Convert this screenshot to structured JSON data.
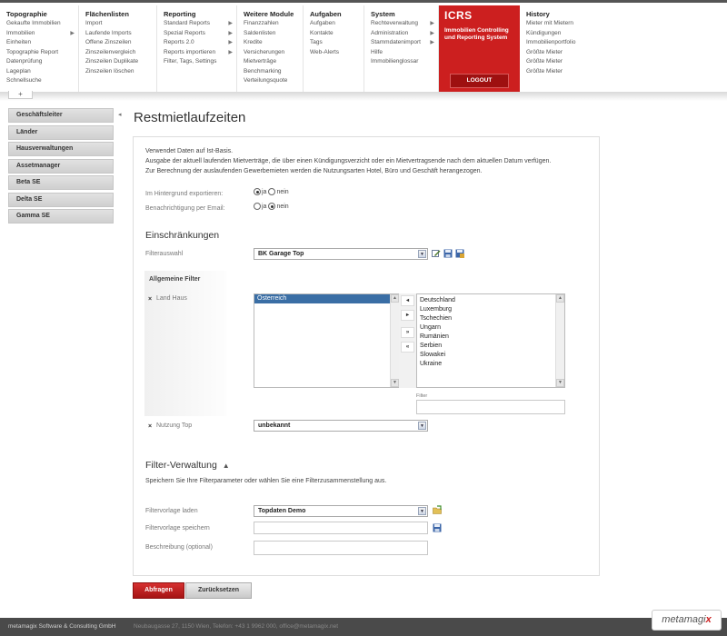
{
  "menu": {
    "topographie": {
      "title": "Topographie",
      "items": [
        "Gekaufte Immobilien",
        "Immobilien",
        "Einheiten",
        "Topographie Report",
        "Datenprüfung",
        "Lageplan",
        "Schnellsuche"
      ]
    },
    "flaechenlisten": {
      "title": "Flächenlisten",
      "items": [
        "Import",
        "Laufende Imports",
        "Offene Zinszeilen",
        "Zinszeilenvergleich",
        "Zinszeilen Duplikate",
        "Zinszeilen löschen"
      ]
    },
    "reporting": {
      "title": "Reporting",
      "items": [
        "Standard Reports",
        "Spezial Reports",
        "Reports 2.0",
        "Reports importieren",
        "Filter, Tags, Settings"
      ]
    },
    "weitere": {
      "title": "Weitere Module",
      "items": [
        "Finanzzahlen",
        "Saldenlisten",
        "Kredite",
        "Versicherungen",
        "Mietverträge",
        "Benchmarking",
        "Verteilungsquote"
      ]
    },
    "aufgaben": {
      "title": "Aufgaben",
      "items": [
        "Aufgaben",
        "Kontakte",
        "Tags",
        "Web-Alerts"
      ]
    },
    "system": {
      "title": "System",
      "items": [
        "Rechteverwaltung",
        "Administration",
        "Stammdatenimport",
        "Hilfe",
        "Immobilienglossar"
      ]
    },
    "icrs": {
      "title": "ICRS",
      "subtitle_line1": "Immobilien Controlling",
      "subtitle_line2": "und Reporting System",
      "logout": "LOGOUT"
    },
    "history": {
      "title": "History",
      "items": [
        "Mieter mit Mietern",
        "Kündigungen",
        "Immobilienportfolio",
        "Größte Mieter",
        "Größte Mieter",
        "Größte Mieter"
      ]
    },
    "toggle": "+"
  },
  "sidebar": {
    "items": [
      "Geschäftsleiter",
      "Länder",
      "Hausverwaltungen",
      "Assetmanager",
      "Beta SE",
      "Delta SE",
      "Gamma SE"
    ],
    "pointer": "◂"
  },
  "page": {
    "title": "Restmietlaufzeiten",
    "intro": [
      "Verwendet Daten auf Ist-Basis.",
      "Ausgabe der aktuell laufenden Mietverträge, die über einen Kündigungsverzicht oder ein Mietvertragsende nach dem aktuellen Datum verfügen.",
      "Zur Berechnung der auslaufenden Gewerbemieten werden die Nutzungsarten Hotel, Büro und Geschäft herangezogen."
    ],
    "export_label": "Im Hintergrund exportieren:",
    "notify_label": "Benachrichtigung per Email:",
    "ja": "ja",
    "nein": "nein",
    "export_value": "ja",
    "notify_value": "nein",
    "restrictions_heading": "Einschränkungen",
    "filter_select_label": "Filterauswahl",
    "filter_select_value": "BK Garage Top",
    "general_filter_heading": "Allgemeine Filter",
    "land_label": "Land Haus",
    "land_selected": [
      "Österreich"
    ],
    "land_available": [
      "Deutschland",
      "Luxemburg",
      "Tschechien",
      "Ungarn",
      "Rumänien",
      "Serbien",
      "Slowakei",
      "Ukraine"
    ],
    "move_buttons": [
      "◂",
      "▸",
      "»",
      "«"
    ],
    "filter_small_label": "Filter",
    "nutzung_label": "Nutzung Top",
    "nutzung_value": "unbekannt",
    "filter_mgmt_heading": "Filter-Verwaltung",
    "filter_mgmt_desc": "Speichern Sie Ihre Filterparameter oder wählen Sie eine Filterzusammenstellung aus.",
    "template_load_label": "Filtervorlage laden",
    "template_load_value": "Topdaten Demo",
    "template_save_label": "Filtervorlage speichern",
    "description_label": "Beschreibung (optional)",
    "query_button": "Abfragen",
    "reset_button": "Zurücksetzen"
  },
  "footer": {
    "company": "metamagix Software & Consulting GmbH",
    "contact": "Neubaugasse 27, 1150 Wien, Telefon: +43 1 9962 000, office@metamagix.net",
    "brand": "metamagi",
    "brand_x": "x"
  },
  "colors": {
    "accent": "#cc1f1f",
    "footer": "#4a4a4a",
    "sidebar": "#d6d6d6"
  }
}
